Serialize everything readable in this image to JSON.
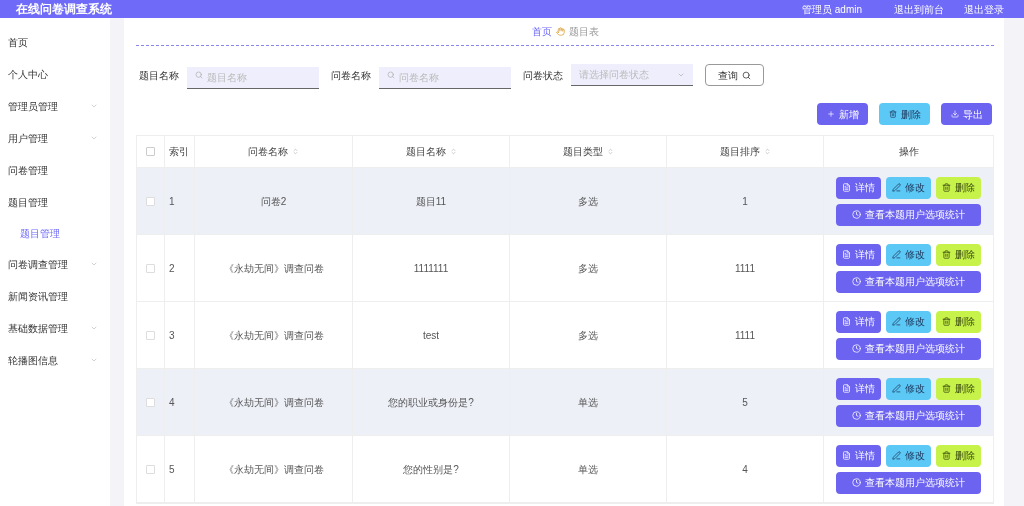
{
  "header": {
    "title": "在线问卷调查系统",
    "user": "管理员 admin",
    "links": [
      "退出到前台",
      "退出登录"
    ]
  },
  "sidebar": {
    "items": [
      {
        "label": "首页",
        "has_caret": false
      },
      {
        "label": "个人中心",
        "has_caret": false
      },
      {
        "label": "管理员管理",
        "has_caret": true
      },
      {
        "label": "用户管理",
        "has_caret": true
      },
      {
        "label": "问卷管理",
        "has_caret": false
      },
      {
        "label": "题目管理",
        "has_caret": false,
        "children": [
          {
            "label": "题目管理",
            "selected": true
          }
        ]
      },
      {
        "label": "问卷调查管理",
        "has_caret": true
      },
      {
        "label": "新闻资讯管理",
        "has_caret": false
      },
      {
        "label": "基础数据管理",
        "has_caret": true
      },
      {
        "label": "轮播图信息",
        "has_caret": true
      }
    ]
  },
  "breadcrumb": [
    "首页",
    "题目表"
  ],
  "filters": [
    {
      "kind": "text",
      "label": "题目名称",
      "placeholder": "题目名称"
    },
    {
      "kind": "text",
      "label": "问卷名称",
      "placeholder": "问卷名称"
    },
    {
      "kind": "select",
      "label": "问卷状态",
      "placeholder": "请选择问卷状态"
    }
  ],
  "search_button": "查询",
  "toolbar": [
    {
      "kind": "add",
      "label": "新增"
    },
    {
      "kind": "delete",
      "label": "删除"
    },
    {
      "kind": "export",
      "label": "导出"
    }
  ],
  "table": {
    "select_all": false,
    "columns": [
      {
        "label": "索引",
        "sortable": false
      },
      {
        "label": "问卷名称",
        "sortable": true
      },
      {
        "label": "题目名称",
        "sortable": true
      },
      {
        "label": "题目类型",
        "sortable": true
      },
      {
        "label": "题目排序",
        "sortable": true
      },
      {
        "label": "操作",
        "sortable": false
      }
    ],
    "rows": [
      {
        "checked": false,
        "highlighted": true,
        "cells": [
          "1",
          "问卷2",
          "题目11",
          "多选",
          "1"
        ],
        "actions": [
          {
            "kind": "detail",
            "label": "详情"
          },
          {
            "kind": "edit",
            "label": "修改"
          },
          {
            "kind": "delete",
            "label": "删除"
          },
          {
            "kind": "stats",
            "label": "查看本题用户选项统计"
          }
        ]
      },
      {
        "checked": false,
        "highlighted": false,
        "cells": [
          "2",
          "《永劫无间》调查问卷",
          "1111111",
          "多选",
          "1111"
        ],
        "actions": [
          {
            "kind": "detail",
            "label": "详情"
          },
          {
            "kind": "edit",
            "label": "修改"
          },
          {
            "kind": "delete",
            "label": "删除"
          },
          {
            "kind": "stats",
            "label": "查看本题用户选项统计"
          }
        ]
      },
      {
        "checked": false,
        "highlighted": false,
        "cells": [
          "3",
          "《永劫无间》调查问卷",
          "test",
          "多选",
          "1111"
        ],
        "actions": [
          {
            "kind": "detail",
            "label": "详情"
          },
          {
            "kind": "edit",
            "label": "修改"
          },
          {
            "kind": "delete",
            "label": "删除"
          },
          {
            "kind": "stats",
            "label": "查看本题用户选项统计"
          }
        ]
      },
      {
        "checked": false,
        "highlighted": true,
        "cells": [
          "4",
          "《永劫无间》调查问卷",
          "您的职业或身份是?",
          "单选",
          "5"
        ],
        "actions": [
          {
            "kind": "detail",
            "label": "详情"
          },
          {
            "kind": "edit",
            "label": "修改"
          },
          {
            "kind": "delete",
            "label": "删除"
          },
          {
            "kind": "stats",
            "label": "查看本题用户选项统计"
          }
        ]
      },
      {
        "checked": false,
        "highlighted": false,
        "cells": [
          "5",
          "《永劫无间》调查问卷",
          "您的性别是?",
          "单选",
          "4"
        ],
        "actions": [
          {
            "kind": "detail",
            "label": "详情"
          },
          {
            "kind": "edit",
            "label": "修改"
          },
          {
            "kind": "delete",
            "label": "删除"
          },
          {
            "kind": "stats",
            "label": "查看本题用户选项统计"
          }
        ]
      }
    ]
  }
}
